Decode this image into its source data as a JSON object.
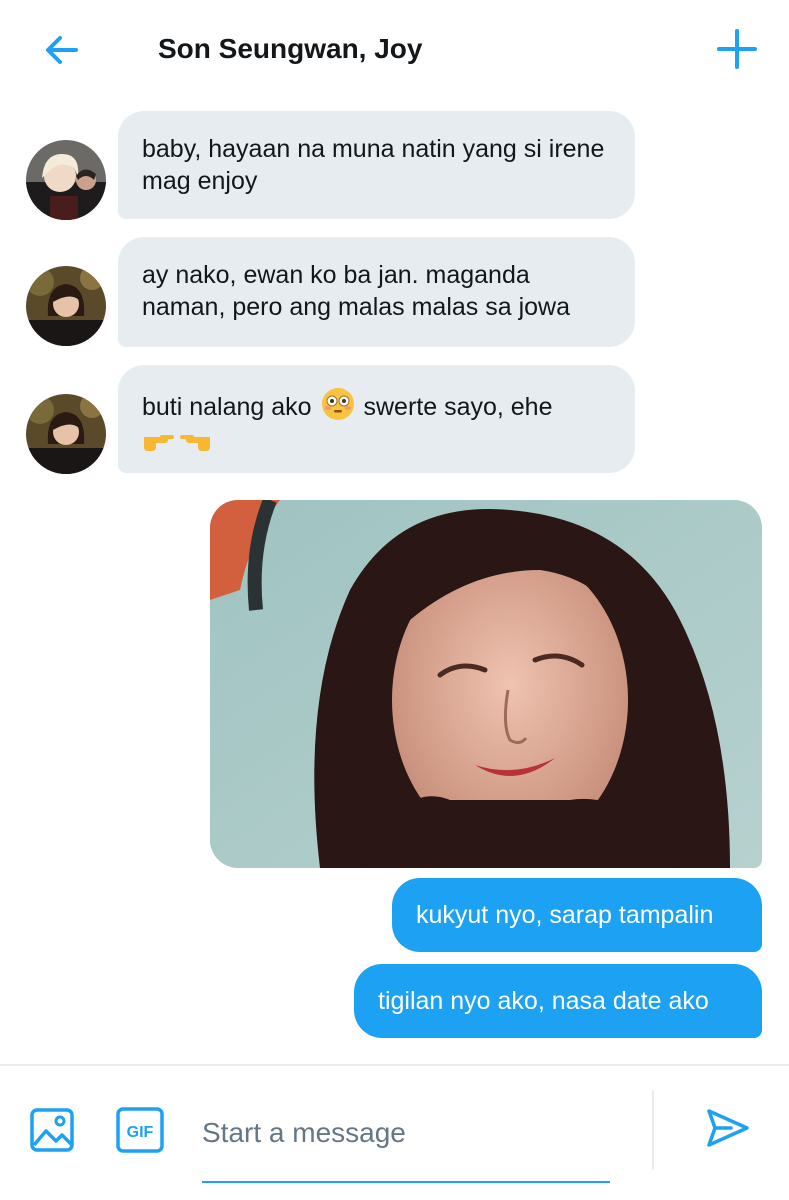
{
  "header": {
    "title": "Son Seungwan, Joy",
    "back_icon": "arrow-left-icon",
    "add_icon": "plus-icon"
  },
  "messages": [
    {
      "direction": "incoming",
      "text": "baby, hayaan na muna natin yang si irene mag enjoy"
    },
    {
      "direction": "incoming",
      "text": "ay nako, ewan ko ba jan. maganda naman, pero ang malas malas sa jowa"
    },
    {
      "direction": "incoming",
      "text_before": "buti nalang ako",
      "emoji": "flushed-face-emoji",
      "text_after": "swerte sayo, ehe",
      "emoji2": "pointing-fingers-emoji"
    },
    {
      "direction": "outgoing",
      "type": "image"
    },
    {
      "direction": "outgoing",
      "text": "kukyut nyo, sarap tampalin"
    },
    {
      "direction": "outgoing",
      "text": "tigilan nyo ako, nasa date ako"
    }
  ],
  "composer": {
    "placeholder": "Start a message",
    "image_icon": "image-icon",
    "gif_label": "GIF",
    "send_icon": "send-icon"
  },
  "colors": {
    "accent": "#1da1f2",
    "incoming_bubble": "#e6ecf0",
    "text": "#14171a",
    "placeholder": "#657786"
  }
}
